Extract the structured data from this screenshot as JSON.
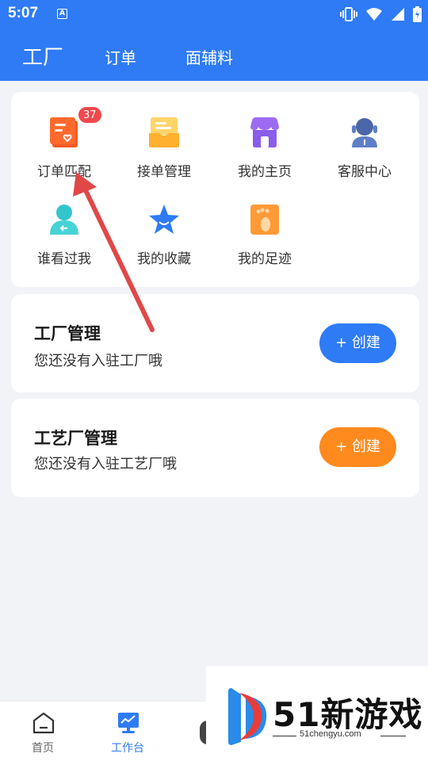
{
  "status_bar": {
    "time": "5:07",
    "notification_letter": "A"
  },
  "top_tabs": [
    {
      "label": "工厂",
      "active": true
    },
    {
      "label": "订单",
      "active": false
    },
    {
      "label": "面辅料",
      "active": false
    }
  ],
  "grid_items": [
    {
      "label": "订单匹配",
      "icon": "order-match-icon",
      "badge": "37"
    },
    {
      "label": "接单管理",
      "icon": "order-accept-icon"
    },
    {
      "label": "我的主页",
      "icon": "my-home-shop-icon"
    },
    {
      "label": "客服中心",
      "icon": "customer-service-icon"
    },
    {
      "label": "谁看过我",
      "icon": "visitors-icon"
    },
    {
      "label": "我的收藏",
      "icon": "favorite-star-icon"
    },
    {
      "label": "我的足迹",
      "icon": "footprint-icon"
    }
  ],
  "factory_mgmt": {
    "title": "工厂管理",
    "subtitle": "您还没有入驻工厂哦",
    "button": "+ 创建"
  },
  "craft_mgmt": {
    "title": "工艺厂管理",
    "subtitle": "您还没有入驻工艺厂哦",
    "button": "+ 创建"
  },
  "bottom_nav": [
    {
      "label": "首页",
      "active": false
    },
    {
      "label": "工作台",
      "active": true
    }
  ],
  "watermark": {
    "text": "51新游戏",
    "url": "51chengyu.com"
  },
  "colors": {
    "primary": "#2f7bf5",
    "orange": "#ff8a1e",
    "badge": "#f0484b",
    "annotation_arrow": "#e04848"
  }
}
